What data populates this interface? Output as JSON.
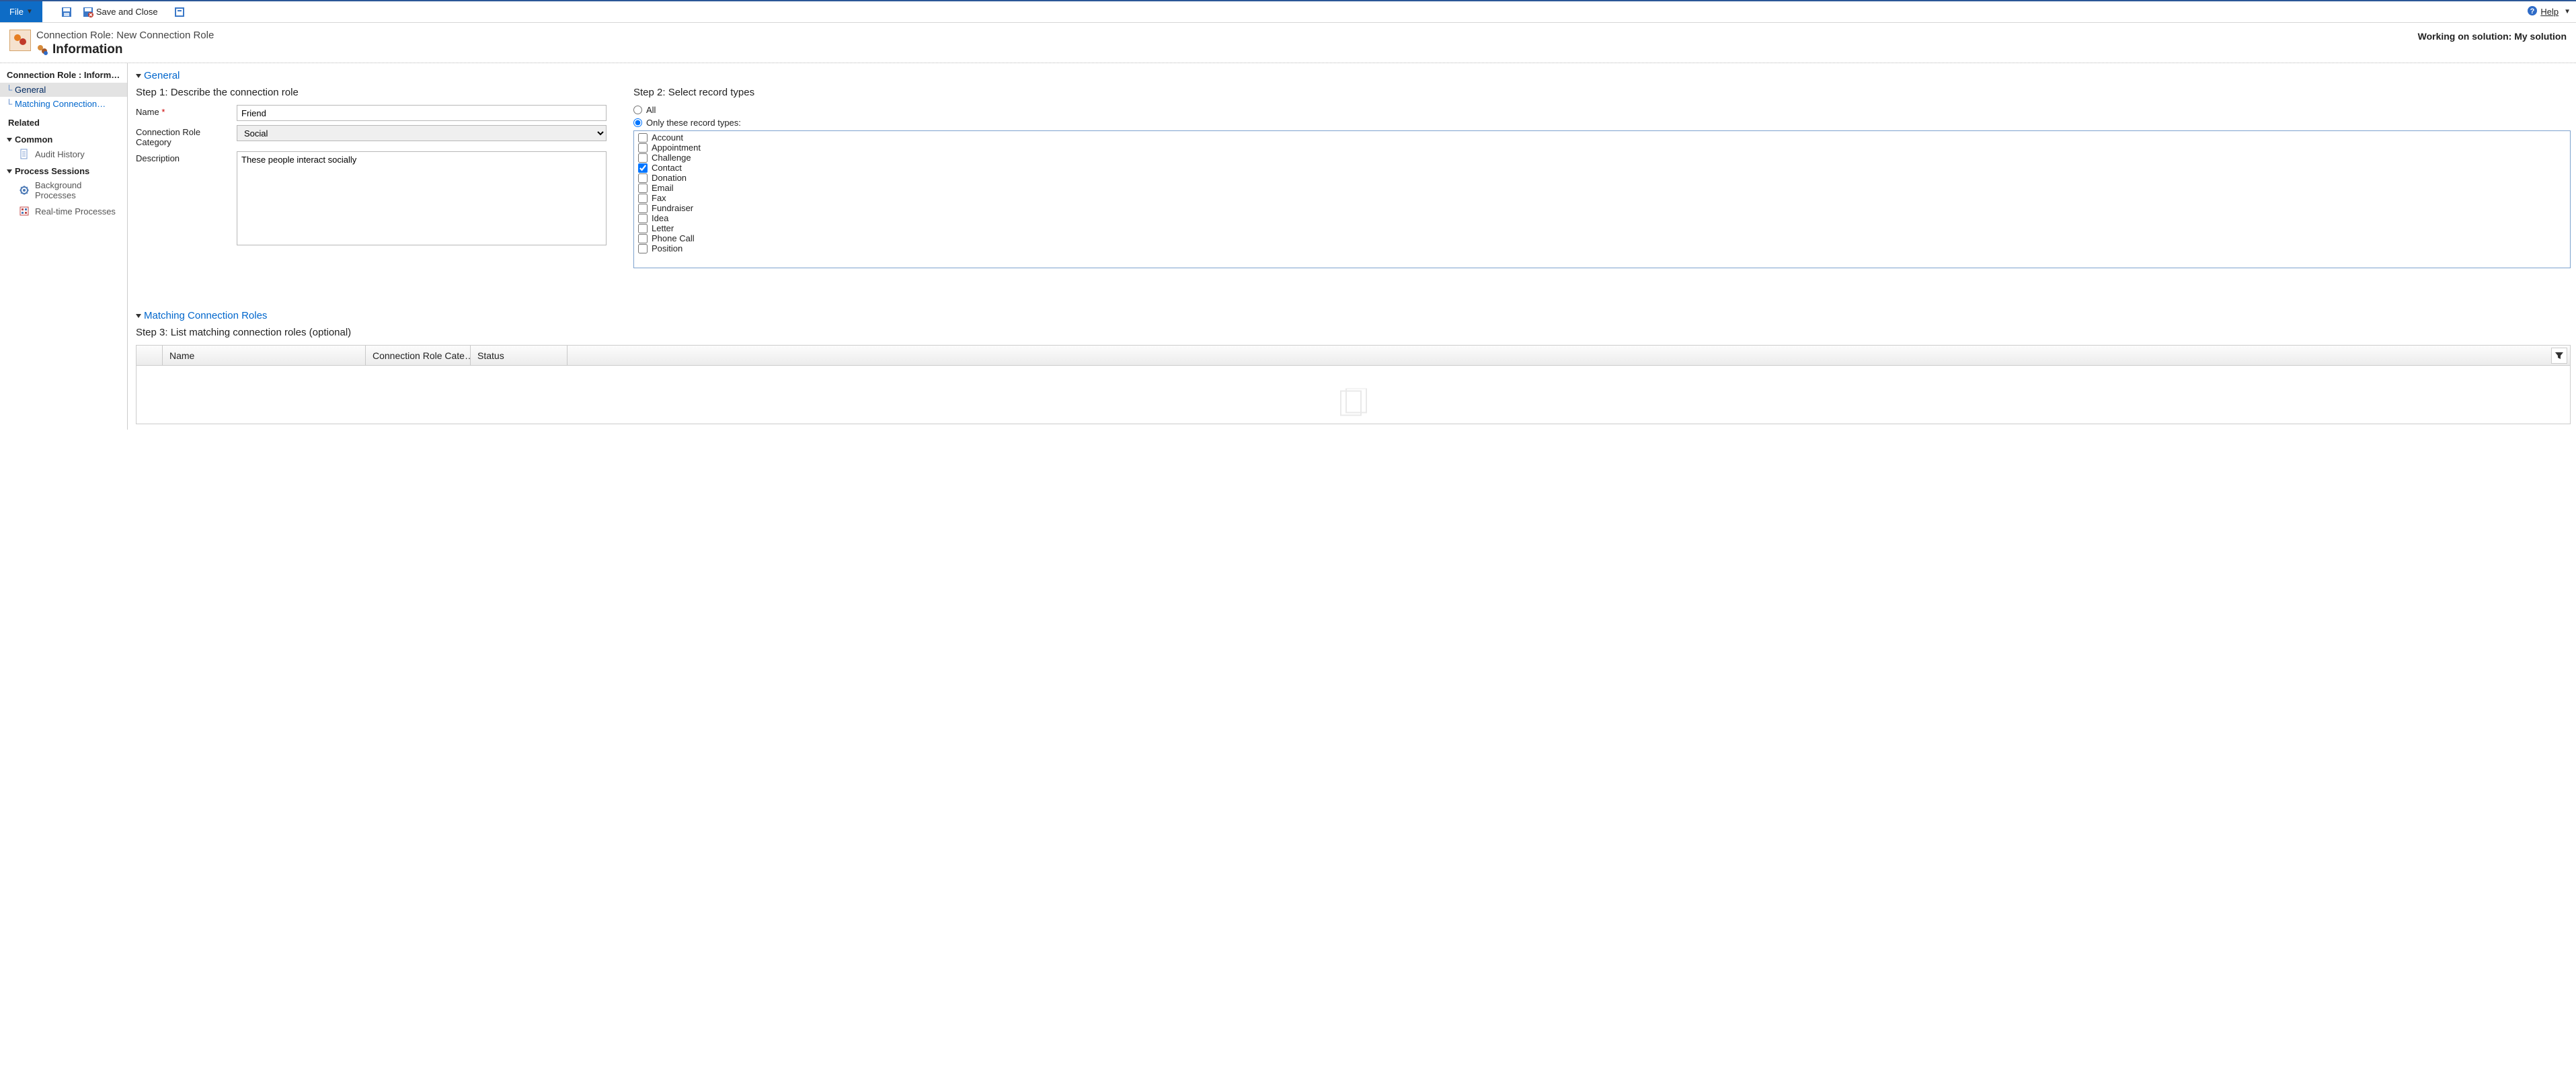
{
  "ribbon": {
    "file_label": "File",
    "save_close_label": "Save and Close",
    "help_label": "Help"
  },
  "header": {
    "breadcrumb": "Connection Role: New Connection Role",
    "title": "Information",
    "working_on": "Working on solution: My solution"
  },
  "sidebar": {
    "head": "Connection Role : Inform…",
    "items": [
      {
        "label": "General"
      },
      {
        "label": "Matching Connection…"
      }
    ],
    "related_label": "Related",
    "group_common": "Common",
    "audit_history": "Audit History",
    "group_process": "Process Sessions",
    "bg_processes": "Background Processes",
    "rt_processes": "Real-time Processes"
  },
  "sections": {
    "general": "General",
    "matching": "Matching Connection Roles"
  },
  "steps": {
    "s1": "Step 1: Describe the connection role",
    "s2": "Step 2: Select record types",
    "s3": "Step 3: List matching connection roles (optional)"
  },
  "form": {
    "name_label": "Name",
    "name_value": "Friend",
    "category_label": "Connection Role Category",
    "category_value": "Social",
    "description_label": "Description",
    "description_value": "These people interact socially"
  },
  "radios": {
    "all": "All",
    "only": "Only these record types:",
    "selected": "only"
  },
  "record_types": [
    {
      "label": "Account",
      "checked": false
    },
    {
      "label": "Appointment",
      "checked": false
    },
    {
      "label": "Challenge",
      "checked": false
    },
    {
      "label": "Contact",
      "checked": true
    },
    {
      "label": "Donation",
      "checked": false
    },
    {
      "label": "Email",
      "checked": false
    },
    {
      "label": "Fax",
      "checked": false
    },
    {
      "label": "Fundraiser",
      "checked": false
    },
    {
      "label": "Idea",
      "checked": false
    },
    {
      "label": "Letter",
      "checked": false
    },
    {
      "label": "Phone Call",
      "checked": false
    },
    {
      "label": "Position",
      "checked": false
    }
  ],
  "grid": {
    "col_name": "Name",
    "col_cat": "Connection Role Cate…",
    "col_status": "Status"
  }
}
